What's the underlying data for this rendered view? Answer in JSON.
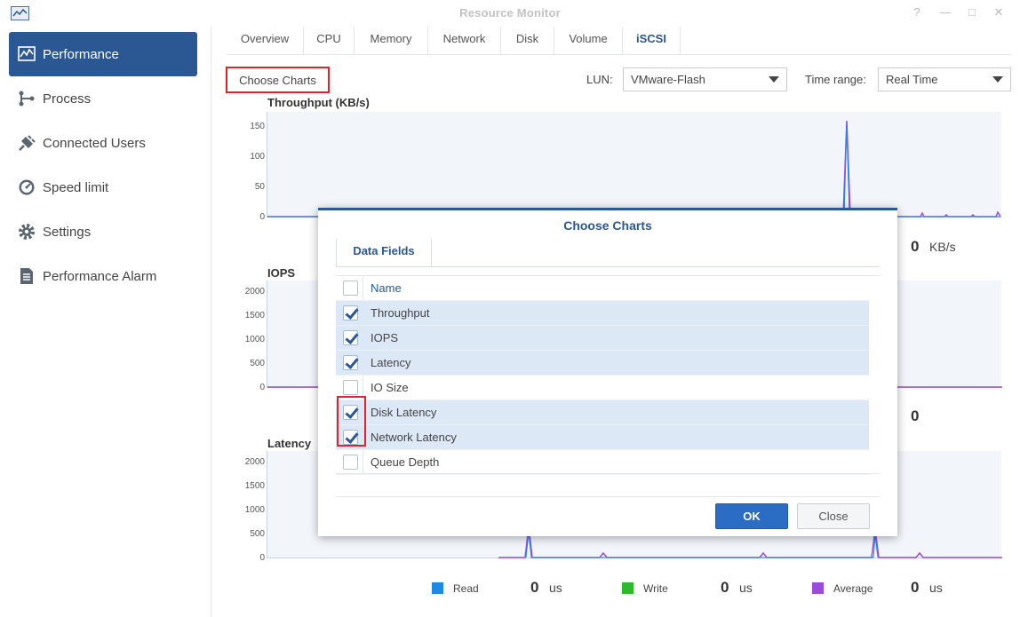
{
  "window": {
    "title": "Resource Monitor",
    "help": "?",
    "minimize": "—",
    "maximize": "□",
    "close": "✕"
  },
  "sidebar": {
    "items": [
      {
        "label": "Performance",
        "icon": "performance-chart-icon",
        "active": true
      },
      {
        "label": "Process",
        "icon": "process-icon"
      },
      {
        "label": "Connected Users",
        "icon": "plug-icon"
      },
      {
        "label": "Speed limit",
        "icon": "speedometer-icon"
      },
      {
        "label": "Settings",
        "icon": "gear-icon"
      },
      {
        "label": "Performance Alarm",
        "icon": "document-icon"
      }
    ]
  },
  "tabs": [
    "Overview",
    "CPU",
    "Memory",
    "Network",
    "Disk",
    "Volume",
    "iSCSI"
  ],
  "active_tab": "iSCSI",
  "toolbar": {
    "choose_charts": "Choose Charts",
    "lun_label": "LUN:",
    "lun_value": "VMware-Flash",
    "time_label": "Time range:",
    "time_value": "Real Time"
  },
  "charts": {
    "throughput": {
      "title": "Throughput (KB/s)",
      "yticks": [
        "150",
        "100",
        "50",
        "0"
      ],
      "value": "0",
      "unit": "KB/s"
    },
    "iops": {
      "title": "IOPS",
      "yticks": [
        "2000",
        "1500",
        "1000",
        "500",
        "0"
      ],
      "value": "0"
    },
    "latency": {
      "title": "Latency",
      "yticks": [
        "2000",
        "1500",
        "1000",
        "500",
        "0"
      ]
    }
  },
  "chart_data": [
    {
      "type": "line",
      "title": "Throughput (KB/s)",
      "ylim": [
        0,
        150
      ],
      "yticks": [
        0,
        50,
        100,
        150
      ],
      "series": [
        {
          "color": "#9a4bdc",
          "peak": 160
        }
      ]
    },
    {
      "type": "line",
      "title": "IOPS",
      "ylim": [
        0,
        2000
      ],
      "yticks": [
        0,
        500,
        1000,
        1500,
        2000
      ]
    },
    {
      "type": "line",
      "title": "Latency",
      "ylim": [
        0,
        2000
      ],
      "yticks": [
        0,
        500,
        1000,
        1500,
        2000
      ]
    }
  ],
  "legend": [
    {
      "label": "Read",
      "color": "#1e88e5",
      "value": "0",
      "unit": "us"
    },
    {
      "label": "Write",
      "color": "#2eb82e",
      "value": "0",
      "unit": "us"
    },
    {
      "label": "Average",
      "color": "#9a4bdc",
      "value": "0",
      "unit": "us"
    }
  ],
  "dialog": {
    "title": "Choose Charts",
    "tab": "Data Fields",
    "column_header": "Name",
    "rows": [
      {
        "name": "Throughput",
        "checked": true
      },
      {
        "name": "IOPS",
        "checked": true
      },
      {
        "name": "Latency",
        "checked": true
      },
      {
        "name": "IO Size",
        "checked": false
      },
      {
        "name": "Disk Latency",
        "checked": true
      },
      {
        "name": "Network Latency",
        "checked": true
      },
      {
        "name": "Queue Depth",
        "checked": false
      }
    ],
    "ok": "OK",
    "close": "Close"
  },
  "colors": {
    "accent": "#2b5793",
    "highlight": "#e0242b",
    "plot_bg": "#f2f6fb",
    "series": "#9a4bdc"
  }
}
